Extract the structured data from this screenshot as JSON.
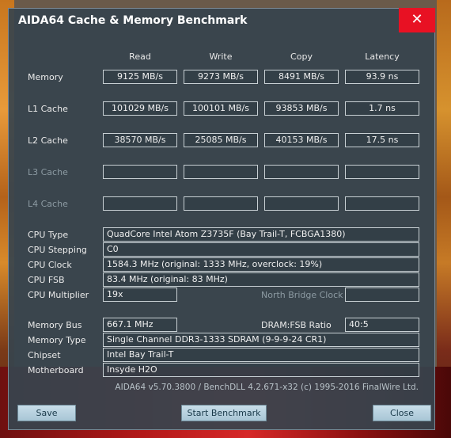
{
  "window": {
    "title": "AIDA64 Cache & Memory Benchmark",
    "close_glyph": "✕"
  },
  "columns": [
    "Read",
    "Write",
    "Copy",
    "Latency"
  ],
  "bench_rows": [
    {
      "label": "Memory",
      "values": [
        "9125 MB/s",
        "9273 MB/s",
        "8491 MB/s",
        "93.9 ns"
      ],
      "enabled": true
    },
    {
      "label": "L1 Cache",
      "values": [
        "101029 MB/s",
        "100101 MB/s",
        "93853 MB/s",
        "1.7 ns"
      ],
      "enabled": true
    },
    {
      "label": "L2 Cache",
      "values": [
        "38570 MB/s",
        "25085 MB/s",
        "40153 MB/s",
        "17.5 ns"
      ],
      "enabled": true
    },
    {
      "label": "L3 Cache",
      "values": [
        "",
        "",
        "",
        ""
      ],
      "enabled": false
    },
    {
      "label": "L4 Cache",
      "values": [
        "",
        "",
        "",
        ""
      ],
      "enabled": false
    }
  ],
  "cpu": {
    "type_label": "CPU Type",
    "type": "QuadCore Intel Atom Z3735F  (Bay Trail-T, FCBGA1380)",
    "stepping_label": "CPU Stepping",
    "stepping": "C0",
    "clock_label": "CPU Clock",
    "clock": "1584.3 MHz  (original: 1333 MHz, overclock: 19%)",
    "fsb_label": "CPU FSB",
    "fsb": "83.4 MHz  (original: 83 MHz)",
    "multiplier_label": "CPU Multiplier",
    "multiplier": "19x",
    "nb_clock_label": "North Bridge Clock",
    "nb_clock": ""
  },
  "memory": {
    "bus_label": "Memory Bus",
    "bus": "667.1 MHz",
    "ratio_label": "DRAM:FSB Ratio",
    "ratio": "40:5",
    "type_label": "Memory Type",
    "type": "Single Channel DDR3-1333 SDRAM  (9-9-9-24 CR1)",
    "chipset_label": "Chipset",
    "chipset": "Intel Bay Trail-T",
    "motherboard_label": "Motherboard",
    "motherboard": "Insyde H2O"
  },
  "footer": "AIDA64 v5.70.3800 / BenchDLL 4.2.671-x32  (c) 1995-2016 FinalWire Ltd.",
  "buttons": {
    "save": "Save",
    "start": "Start Benchmark",
    "close": "Close"
  }
}
